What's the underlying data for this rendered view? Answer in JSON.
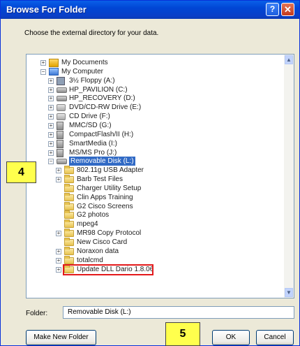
{
  "window": {
    "title": "Browse For Folder",
    "help_glyph": "?",
    "close_glyph": "✕"
  },
  "instruction": "Choose the external directory for your data.",
  "tree": {
    "items": [
      {
        "label": "My Documents",
        "icon": "my-documents-icon",
        "expander": "+"
      },
      {
        "label": "My Computer",
        "icon": "my-computer-icon",
        "expander": "−"
      },
      {
        "label": "3½ Floppy (A:)",
        "icon": "floppy-icon",
        "expander": "+"
      },
      {
        "label": "HP_PAVILION (C:)",
        "icon": "drive-icon",
        "expander": "+"
      },
      {
        "label": "HP_RECOVERY (D:)",
        "icon": "drive-icon",
        "expander": "+"
      },
      {
        "label": "DVD/CD-RW Drive (E:)",
        "icon": "cd-drive-icon",
        "expander": "+"
      },
      {
        "label": "CD Drive (F:)",
        "icon": "cd-drive-icon",
        "expander": "+"
      },
      {
        "label": "MMC/SD (G:)",
        "icon": "card-reader-icon",
        "expander": "+"
      },
      {
        "label": "CompactFlash/II (H:)",
        "icon": "card-reader-icon",
        "expander": "+"
      },
      {
        "label": "SmartMedia (I:)",
        "icon": "card-reader-icon",
        "expander": "+"
      },
      {
        "label": "MS/MS Pro (J:)",
        "icon": "card-reader-icon",
        "expander": "+"
      },
      {
        "label": "Removable Disk (L:)",
        "icon": "removable-disk-icon",
        "expander": "−",
        "selected": true
      },
      {
        "label": "802.11g USB Adapter",
        "icon": "folder-icon",
        "expander": "+"
      },
      {
        "label": "Barb Test Files",
        "icon": "folder-icon",
        "expander": "+"
      },
      {
        "label": "Charger Utility Setup",
        "icon": "folder-icon"
      },
      {
        "label": "Clin Apps Training",
        "icon": "folder-icon"
      },
      {
        "label": "G2 Cisco Screens",
        "icon": "folder-icon"
      },
      {
        "label": "G2 photos",
        "icon": "folder-icon"
      },
      {
        "label": "mpeg4",
        "icon": "folder-icon"
      },
      {
        "label": "MR98 Copy Protocol",
        "icon": "folder-icon",
        "expander": "+"
      },
      {
        "label": "New Cisco Card",
        "icon": "folder-icon"
      },
      {
        "label": "Noraxon data",
        "icon": "folder-icon",
        "expander": "+",
        "highlighted": true
      },
      {
        "label": "totalcmd",
        "icon": "folder-icon",
        "expander": "+"
      },
      {
        "label": "Update DLL Dario 1.8.06",
        "icon": "folder-icon",
        "expander": "+"
      }
    ]
  },
  "folder_field": {
    "label": "Folder:",
    "value": "Removable Disk (L:)"
  },
  "buttons": {
    "make_new_folder": "Make New Folder",
    "ok": "OK",
    "cancel": "Cancel"
  },
  "callouts": {
    "step4": "4",
    "step5": "5"
  },
  "colors": {
    "highlight_box": "#e3191b",
    "callout_fill": "#ffff4d",
    "selection": "#316ac5"
  }
}
